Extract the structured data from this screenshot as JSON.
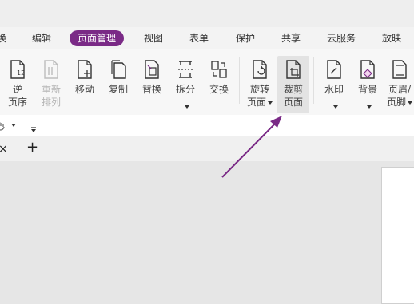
{
  "menu": [
    {
      "label": "换",
      "active": false
    },
    {
      "label": "编辑",
      "active": false
    },
    {
      "label": "页面管理",
      "active": true
    },
    {
      "label": "视图",
      "active": false
    },
    {
      "label": "表单",
      "active": false
    },
    {
      "label": "保护",
      "active": false
    },
    {
      "label": "共享",
      "active": false
    },
    {
      "label": "云服务",
      "active": false
    },
    {
      "label": "放映",
      "active": false
    }
  ],
  "ribbon": [
    {
      "label1": "逆",
      "label2": "页序",
      "icon": "reverse-page-order-icon",
      "enabled": true,
      "dropdown": false
    },
    {
      "label1": "重新",
      "label2": "排列",
      "icon": "rearrange-icon",
      "enabled": false,
      "dropdown": false
    },
    {
      "label1": "移动",
      "label2": "",
      "icon": "move-page-icon",
      "enabled": true,
      "dropdown": false
    },
    {
      "label1": "复制",
      "label2": "",
      "icon": "copy-page-icon",
      "enabled": true,
      "dropdown": false
    },
    {
      "label1": "替换",
      "label2": "",
      "icon": "replace-page-icon",
      "enabled": true,
      "dropdown": false
    },
    {
      "label1": "拆分",
      "label2": "",
      "icon": "split-page-icon",
      "enabled": true,
      "dropdown": true
    },
    {
      "label1": "交换",
      "label2": "",
      "icon": "swap-page-icon",
      "enabled": true,
      "dropdown": false
    },
    {
      "label1": "旋转",
      "label2": "页面",
      "icon": "rotate-page-icon",
      "enabled": true,
      "dropdown": true
    },
    {
      "label1": "裁剪",
      "label2": "页面",
      "icon": "crop-page-icon",
      "enabled": true,
      "dropdown": false,
      "active": true
    },
    {
      "label1": "水印",
      "label2": "",
      "icon": "watermark-icon",
      "enabled": true,
      "dropdown": true
    },
    {
      "label1": "背景",
      "label2": "",
      "icon": "background-icon",
      "enabled": true,
      "dropdown": true
    },
    {
      "label1": "页眉/",
      "label2": "页脚",
      "icon": "header-footer-icon",
      "enabled": true,
      "dropdown": true
    }
  ],
  "tabs": {
    "close_glyph": "×",
    "add_glyph": "+"
  },
  "colors": {
    "accent": "#7a2a86",
    "annotation_arrow": "#7a2a86"
  }
}
